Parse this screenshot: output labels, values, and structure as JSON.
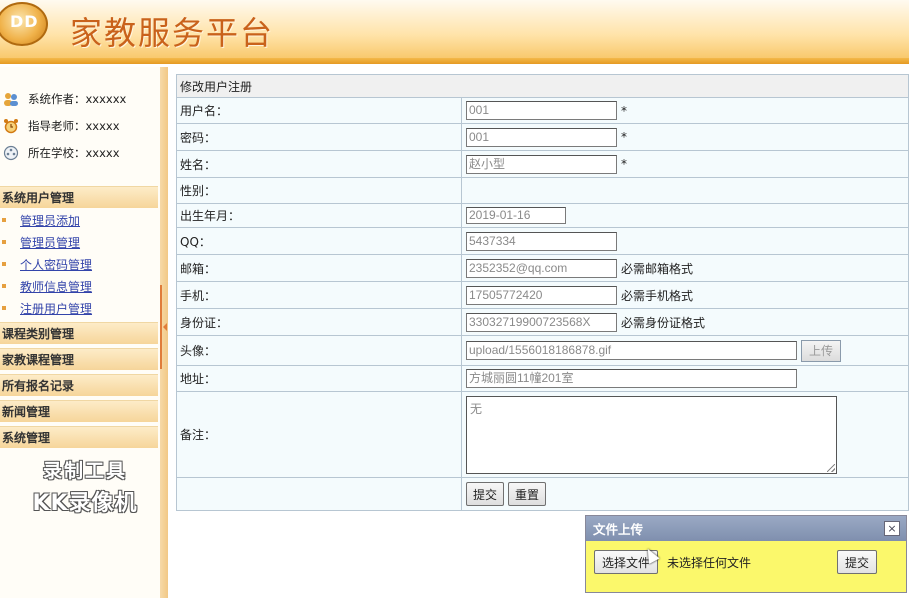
{
  "header": {
    "logo_text": "DD",
    "title": "家教服务平台"
  },
  "sidebar": {
    "info": [
      {
        "icon": "users-icon",
        "label": "系统作者：xxxxxx"
      },
      {
        "icon": "alarm-clock-icon",
        "label": "指导老师：xxxxx"
      },
      {
        "icon": "film-reel-icon",
        "label": "所在学校：xxxxx"
      }
    ],
    "sections": [
      {
        "title": "系统用户管理",
        "items": [
          "管理员添加",
          "管理员管理",
          "个人密码管理",
          "教师信息管理",
          "注册用户管理"
        ]
      },
      {
        "title": "课程类别管理"
      },
      {
        "title": "家教课程管理"
      },
      {
        "title": "所有报名记录"
      },
      {
        "title": "新闻管理"
      },
      {
        "title": "系统管理"
      }
    ],
    "watermark": {
      "line1": "录制工具",
      "line2": "KK录像机"
    }
  },
  "form": {
    "title": "修改用户注册",
    "fields": {
      "username": {
        "label": "用户名：",
        "value": "001",
        "hint": "*"
      },
      "password": {
        "label": "密码：",
        "value": "001",
        "hint": "*"
      },
      "name": {
        "label": "姓名：",
        "value": "赵小型",
        "hint": "*"
      },
      "gender": {
        "label": "性别："
      },
      "birth": {
        "label": "出生年月：",
        "value": "2019-01-16"
      },
      "qq": {
        "label": "QQ：",
        "value": "5437334"
      },
      "email": {
        "label": "邮箱：",
        "value": "2352352@qq.com",
        "hint": "必需邮箱格式"
      },
      "phone": {
        "label": "手机：",
        "value": "17505772420",
        "hint": "必需手机格式"
      },
      "idcard": {
        "label": "身份证：",
        "value": "33032719900723568X",
        "hint": "必需身份证格式"
      },
      "avatar": {
        "label": "头像：",
        "value": "upload/1556018186878.gif",
        "button": "上传"
      },
      "address": {
        "label": "地址：",
        "value": "方城丽圆11幢201室"
      },
      "remark": {
        "label": "备注：",
        "value": "无"
      }
    },
    "submit_label": "提交",
    "reset_label": "重置"
  },
  "upload_popup": {
    "title": "文件上传",
    "close": "×",
    "choose_label": "选择文件",
    "no_file_text": "未选择任何文件",
    "submit_label": "提交"
  }
}
